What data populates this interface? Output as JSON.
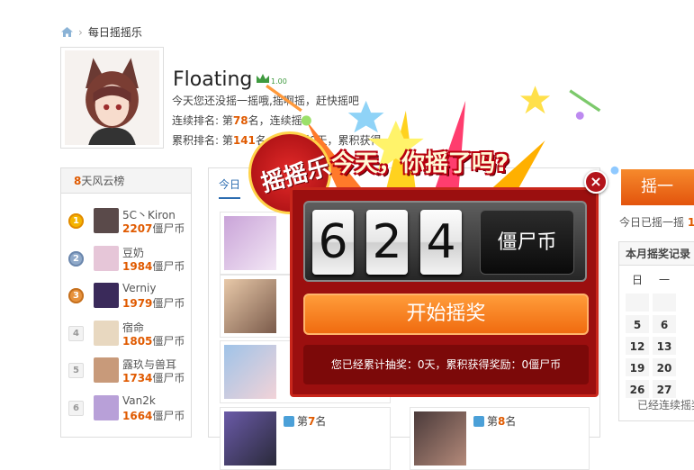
{
  "breadcrumb": {
    "current": "每日摇摇乐"
  },
  "profile": {
    "name": "Floating",
    "level": "1.00",
    "line1": "今天您还没摇一摇哦,摇啊摇，赶快摇吧",
    "rank_prefix": "连续排名: 第",
    "rank_value": "78",
    "rank_suffix": "名，连续摇",
    "total_prefix": "累积排名: 第",
    "total_value": "141",
    "total_suffix": "名，累计摇0天，累积获得"
  },
  "leaderboard": {
    "title_num": "8",
    "title_text": "天风云榜",
    "unit": "僵尸币",
    "rows": [
      {
        "rank": "1",
        "name": "5C丶Kiron",
        "coins": "2207"
      },
      {
        "rank": "2",
        "name": "豆奶",
        "coins": "1984"
      },
      {
        "rank": "3",
        "name": "Verniy",
        "coins": "1979"
      },
      {
        "rank": "4",
        "name": "宿命",
        "coins": "1805"
      },
      {
        "rank": "5",
        "name": "露玖与兽耳",
        "coins": "1734"
      },
      {
        "rank": "6",
        "name": "Van2k",
        "coins": "1664"
      }
    ]
  },
  "center": {
    "tab_label": "今日",
    "cards": [
      {
        "prefix": "第",
        "num": "7",
        "suffix": "名"
      },
      {
        "prefix": "第",
        "num": "8",
        "suffix": "名"
      }
    ]
  },
  "right": {
    "shake_label": "摇一",
    "today_text": "今日已摇一摇",
    "today_num": "1",
    "calendar": {
      "title": "本月摇奖记录",
      "headers": [
        "日",
        "一"
      ],
      "rows": [
        [
          "",
          ""
        ],
        [
          "5",
          "6"
        ],
        [
          "12",
          "13"
        ],
        [
          "19",
          "20"
        ],
        [
          "26",
          "27"
        ]
      ],
      "footer": "已经连续摇奖"
    }
  },
  "popup": {
    "badge": "摇摇乐",
    "title": "今天，你摇了吗?",
    "digits": [
      "6",
      "2",
      "4"
    ],
    "unit": "僵尸币",
    "start_label": "开始摇奖",
    "summary": "您已经累计抽奖：0天，累积获得奖励：0僵尸币",
    "close_label": "×"
  },
  "colors": {
    "accent": "#e05a00",
    "popup_red": "#9b0f0f",
    "start_orange": "#f06b10"
  }
}
